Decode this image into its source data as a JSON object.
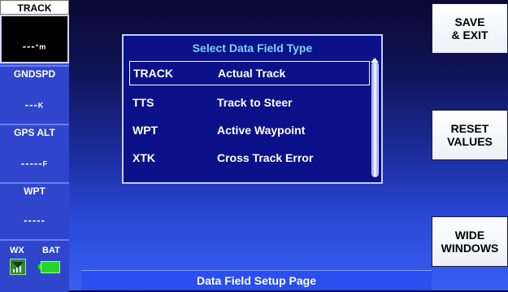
{
  "sidebar": {
    "fields": [
      {
        "label": "TRACK",
        "value": "---",
        "unit": "°m",
        "selected": true
      },
      {
        "label": "GNDSPD",
        "value": "---",
        "unit": "K"
      },
      {
        "label": "GPS ALT",
        "value": "-----",
        "unit": "F"
      },
      {
        "label": "WPT",
        "value": "-----"
      }
    ],
    "status": {
      "wx_label": "WX",
      "bat_label": "BAT"
    }
  },
  "softkeys": {
    "save_exit": "SAVE\n& EXIT",
    "reset_values": "RESET\nVALUES",
    "wide_windows": "WIDE\nWINDOWS"
  },
  "dialog": {
    "title": "Select Data Field Type",
    "options": [
      {
        "code": "TRACK",
        "description": "Actual Track",
        "selected": true
      },
      {
        "code": "TTS",
        "description": "Track to Steer"
      },
      {
        "code": "WPT",
        "description": "Active Waypoint"
      },
      {
        "code": "XTK",
        "description": "Cross Track Error"
      }
    ]
  },
  "footer": {
    "page_title": "Data Field Setup Page"
  },
  "colors": {
    "background": "#1a2a96",
    "dialog_background": "#0b1188",
    "dialog_title": "#7fd0ff",
    "battery": "#26d626"
  }
}
